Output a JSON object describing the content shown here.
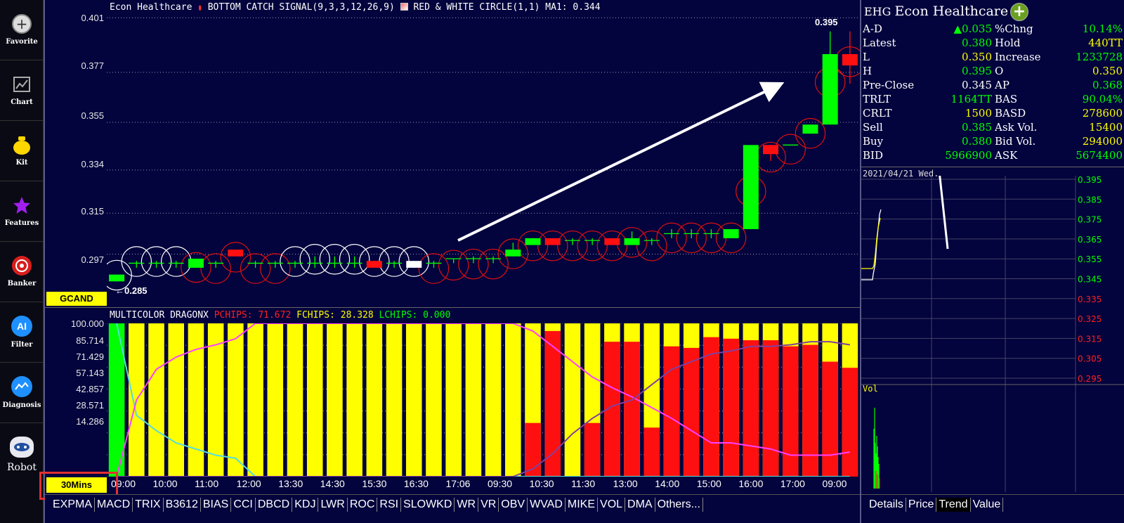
{
  "sidebar": {
    "items": [
      {
        "label": "Favorite",
        "icon": "plus-circle-icon"
      },
      {
        "label": "Chart",
        "icon": "chart-icon"
      },
      {
        "label": "Kit",
        "icon": "money-bag-icon"
      },
      {
        "label": "Features",
        "icon": "star-icon"
      },
      {
        "label": "Banker",
        "icon": "target-icon"
      },
      {
        "label": "Filter",
        "icon": "ai-icon"
      },
      {
        "label": "Diagnosis",
        "icon": "diagnosis-icon"
      },
      {
        "label": "Robot",
        "icon": "robot-icon"
      }
    ]
  },
  "main": {
    "title_name": "Econ Healthcare",
    "indicator1": "BOTTOM CATCH SIGNAL(9,3,3,12,26,9)",
    "indicator2": "RED & WHITE CIRCLE(1,1)",
    "ma_label": "MA1: 0.344",
    "high_label": "0.395",
    "low_label": "0.285",
    "gcand_label": "GCAND",
    "period_label": "30Mins",
    "price_axis": [
      "0.401",
      "0.377",
      "0.355",
      "0.334",
      "0.315",
      "0.297"
    ],
    "sub_title": "MULTICOLOR DRAGONX",
    "pchips": "PCHIPS: 71.672",
    "fchips": "FCHIPS: 28.328",
    "lchips": "LCHIPS: 0.000",
    "sub_axis": [
      "100.000",
      "85.714",
      "71.429",
      "57.143",
      "42.857",
      "28.571",
      "14.286"
    ],
    "time_axis": [
      "09:00",
      "10:00",
      "11:00",
      "12:00",
      "13:30",
      "14:30",
      "15:30",
      "16:30",
      "17:06",
      "09:30",
      "10:30",
      "11:30",
      "13:00",
      "14:00",
      "15:00",
      "16:00",
      "17:00",
      "09:00"
    ],
    "tabs": [
      "EXPMA",
      "MACD",
      "TRIX",
      "B3612",
      "BIAS",
      "CCI",
      "DBCD",
      "KDJ",
      "LWR",
      "ROC",
      "RSI",
      "SLOWKD",
      "WR",
      "VR",
      "OBV",
      "WVAD",
      "MIKE",
      "VOL",
      "DMA",
      "Others..."
    ]
  },
  "chart_data": {
    "type": "candlestick",
    "candles": [
      {
        "o": 0.285,
        "c": 0.288,
        "h": 0.288,
        "l": 0.285,
        "color": "green"
      },
      {
        "o": 0.293,
        "c": 0.293,
        "h": 0.294,
        "l": 0.291,
        "color": "flat"
      },
      {
        "o": 0.293,
        "c": 0.293,
        "h": 0.294,
        "l": 0.291,
        "color": "flat"
      },
      {
        "o": 0.293,
        "c": 0.293,
        "h": 0.294,
        "l": 0.291,
        "color": "flat"
      },
      {
        "o": 0.291,
        "c": 0.295,
        "h": 0.295,
        "l": 0.291,
        "color": "green"
      },
      {
        "o": 0.293,
        "c": 0.293,
        "h": 0.294,
        "l": 0.291,
        "color": "flat"
      },
      {
        "o": 0.299,
        "c": 0.296,
        "h": 0.299,
        "l": 0.296,
        "color": "red"
      },
      {
        "o": 0.293,
        "c": 0.293,
        "h": 0.294,
        "l": 0.291,
        "color": "flat"
      },
      {
        "o": 0.293,
        "c": 0.293,
        "h": 0.294,
        "l": 0.291,
        "color": "flat"
      },
      {
        "o": 0.293,
        "c": 0.293,
        "h": 0.294,
        "l": 0.291,
        "color": "flat"
      },
      {
        "o": 0.293,
        "c": 0.293,
        "h": 0.296,
        "l": 0.291,
        "color": "flat"
      },
      {
        "o": 0.293,
        "c": 0.293,
        "h": 0.296,
        "l": 0.291,
        "color": "flat"
      },
      {
        "o": 0.293,
        "c": 0.293,
        "h": 0.296,
        "l": 0.291,
        "color": "flat"
      },
      {
        "o": 0.294,
        "c": 0.291,
        "h": 0.294,
        "l": 0.291,
        "color": "red"
      },
      {
        "o": 0.293,
        "c": 0.293,
        "h": 0.294,
        "l": 0.291,
        "color": "flat"
      },
      {
        "o": 0.291,
        "c": 0.294,
        "h": 0.294,
        "l": 0.291,
        "color": "white"
      },
      {
        "o": 0.293,
        "c": 0.293,
        "h": 0.294,
        "l": 0.291,
        "color": "flat"
      },
      {
        "o": 0.295,
        "c": 0.295,
        "h": 0.295,
        "l": 0.293,
        "color": "flat"
      },
      {
        "o": 0.295,
        "c": 0.295,
        "h": 0.296,
        "l": 0.293,
        "color": "flat"
      },
      {
        "o": 0.295,
        "c": 0.295,
        "h": 0.296,
        "l": 0.293,
        "color": "flat"
      },
      {
        "o": 0.296,
        "c": 0.299,
        "h": 0.302,
        "l": 0.296,
        "color": "green"
      },
      {
        "o": 0.301,
        "c": 0.304,
        "h": 0.304,
        "l": 0.301,
        "color": "green"
      },
      {
        "o": 0.304,
        "c": 0.301,
        "h": 0.304,
        "l": 0.301,
        "color": "red"
      },
      {
        "o": 0.303,
        "c": 0.303,
        "h": 0.304,
        "l": 0.301,
        "color": "flat"
      },
      {
        "o": 0.303,
        "c": 0.303,
        "h": 0.304,
        "l": 0.301,
        "color": "flat"
      },
      {
        "o": 0.304,
        "c": 0.301,
        "h": 0.304,
        "l": 0.301,
        "color": "red"
      },
      {
        "o": 0.301,
        "c": 0.304,
        "h": 0.307,
        "l": 0.301,
        "color": "green"
      },
      {
        "o": 0.303,
        "c": 0.303,
        "h": 0.304,
        "l": 0.301,
        "color": "flat"
      },
      {
        "o": 0.306,
        "c": 0.306,
        "h": 0.308,
        "l": 0.304,
        "color": "flat"
      },
      {
        "o": 0.306,
        "c": 0.306,
        "h": 0.308,
        "l": 0.304,
        "color": "flat"
      },
      {
        "o": 0.306,
        "c": 0.306,
        "h": 0.308,
        "l": 0.304,
        "color": "flat"
      },
      {
        "o": 0.304,
        "c": 0.308,
        "h": 0.308,
        "l": 0.304,
        "color": "green"
      },
      {
        "o": 0.308,
        "c": 0.345,
        "h": 0.345,
        "l": 0.308,
        "color": "green"
      },
      {
        "o": 0.345,
        "c": 0.341,
        "h": 0.345,
        "l": 0.338,
        "color": "red"
      },
      {
        "o": 0.345,
        "c": 0.345,
        "h": 0.345,
        "l": 0.345,
        "color": "flat"
      },
      {
        "o": 0.35,
        "c": 0.354,
        "h": 0.354,
        "l": 0.35,
        "color": "green"
      },
      {
        "o": 0.354,
        "c": 0.385,
        "h": 0.395,
        "l": 0.354,
        "color": "green"
      },
      {
        "o": 0.385,
        "c": 0.38,
        "h": 0.395,
        "l": 0.372,
        "color": "red"
      }
    ],
    "chips_red": [
      0,
      0,
      0,
      0,
      0,
      0,
      0,
      0,
      0,
      0,
      0,
      0,
      0,
      0,
      0,
      0,
      0,
      0,
      0,
      0,
      0,
      35,
      95,
      0,
      35,
      88,
      88,
      32,
      85,
      84,
      91,
      90,
      89,
      89,
      85,
      86,
      75,
      71
    ],
    "ylim": [
      0.282,
      0.402
    ]
  },
  "quote": {
    "code": "EHG",
    "name": "Econ Healthcare",
    "rows": [
      {
        "l1": "A-D",
        "v1": "▲0.035",
        "c1": "g",
        "l2": "%Chng",
        "v2": "10.14%",
        "c2": "g"
      },
      {
        "l1": "Latest",
        "v1": "0.380",
        "c1": "g",
        "l2": "Hold",
        "v2": "440TT",
        "c2": "y"
      },
      {
        "l1": "L",
        "v1": "0.350",
        "c1": "y",
        "l2": "Increase",
        "v2": "1233728",
        "c2": "g"
      },
      {
        "l1": "H",
        "v1": "0.395",
        "c1": "g",
        "l2": "O",
        "v2": "0.350",
        "c2": "y"
      },
      {
        "l1": "Pre-Close",
        "v1": "0.345",
        "c1": "w",
        "l2": "AP",
        "v2": "0.368",
        "c2": "g"
      },
      {
        "l1": "TRLT",
        "v1": "1164TT",
        "c1": "g",
        "l2": "BAS",
        "v2": "90.04%",
        "c2": "g"
      },
      {
        "l1": "CRLT",
        "v1": "1500",
        "c1": "y",
        "l2": "BASD",
        "v2": "278600",
        "c2": "y"
      },
      {
        "l1": "Sell",
        "v1": "0.385",
        "c1": "g",
        "l2": "Ask Vol.",
        "v2": "15400",
        "c2": "y"
      },
      {
        "l1": "Buy",
        "v1": "0.380",
        "c1": "g",
        "l2": "Bid Vol.",
        "v2": "294000",
        "c2": "y"
      },
      {
        "l1": "BID",
        "v1": "5966900",
        "c1": "g",
        "l2": "ASK",
        "v2": "5674400",
        "c2": "g"
      }
    ],
    "date_label": "2021/04/21 Wed.",
    "trend_axis": [
      "0.395",
      "0.385",
      "0.375",
      "0.365",
      "0.355",
      "0.345",
      "0.335",
      "0.325",
      "0.315",
      "0.305",
      "0.295"
    ],
    "vol_label": "Vol",
    "bottom_tabs": [
      "Details",
      "Price",
      "Trend",
      "Value"
    ]
  }
}
